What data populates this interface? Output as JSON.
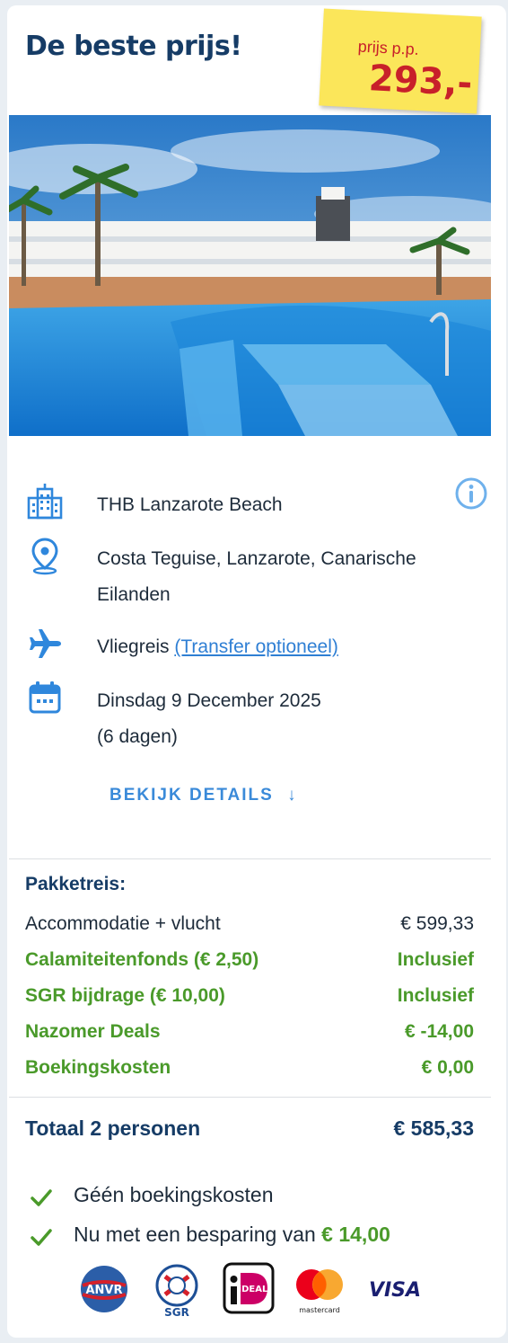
{
  "title": "De beste prijs!",
  "price_tag": {
    "label": "prijs p.p.",
    "amount": "293,-"
  },
  "hotel": {
    "name": "THB Lanzarote Beach"
  },
  "location": "Costa Teguise, Lanzarote, Canarische Eilanden",
  "travel": {
    "type": "Vliegreis",
    "transfer_link": "(Transfer optioneel)"
  },
  "dates": {
    "date": "Dinsdag 9 December 2025",
    "duration": "(6 dagen)"
  },
  "details_button": "BEKIJK DETAILS",
  "package": {
    "title": "Pakketreis:",
    "lines": [
      {
        "label": "Accommodatie + vlucht",
        "value": "€ 599,33"
      },
      {
        "label": "Calamiteitenfonds (€ 2,50)",
        "value": "Inclusief"
      },
      {
        "label": "SGR bijdrage (€ 10,00)",
        "value": "Inclusief"
      },
      {
        "label": "Nazomer Deals",
        "value": "€ -14,00"
      },
      {
        "label": "Boekingskosten",
        "value": "€ 0,00"
      }
    ]
  },
  "total": {
    "label": "Totaal 2 personen",
    "value": "€ 585,33"
  },
  "benefits": {
    "no_booking_costs": "Géén boekingskosten",
    "savings_text": "Nu met een besparing van",
    "savings_amount": "€ 14,00"
  },
  "logos": {
    "anvr": "ANVR",
    "sgr": "SGR",
    "ideal": "iDEAL",
    "mastercard": "mastercard",
    "visa": "VISA"
  },
  "colors": {
    "brand_blue": "#163c66",
    "accent_blue": "#3a8ad9",
    "green": "#4a9a2a",
    "price_red": "#c8202a",
    "tag_yellow": "#fbe65a"
  }
}
